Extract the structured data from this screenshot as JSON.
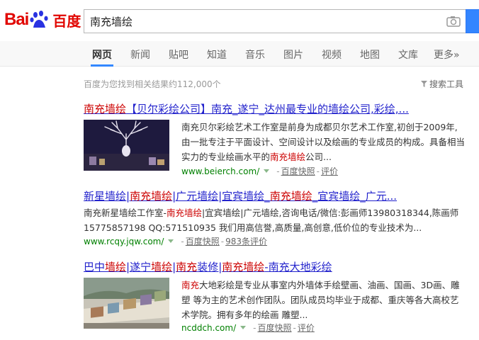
{
  "logo": {
    "text_left": "Bai",
    "text_right": "du",
    "text_cn": "百度"
  },
  "search": {
    "query": "南充墙绘"
  },
  "nav": {
    "tabs": [
      {
        "label": "网页",
        "active": true
      },
      {
        "label": "新闻"
      },
      {
        "label": "贴吧"
      },
      {
        "label": "知道"
      },
      {
        "label": "音乐"
      },
      {
        "label": "图片"
      },
      {
        "label": "视频"
      },
      {
        "label": "地图"
      },
      {
        "label": "文库"
      },
      {
        "label": "更多»"
      }
    ]
  },
  "meta": {
    "result_count": "百度为您找到相关结果约112,000个",
    "tools_label": "搜索工具"
  },
  "results": [
    {
      "title": [
        {
          "t": "南充墙绘",
          "hl": true
        },
        {
          "t": "【贝尔彩绘公司】南充_遂宁_达州最专业的墙绘公司,彩绘,...",
          "hl": false
        }
      ],
      "desc": [
        {
          "t": "南充贝尔彩绘艺术工作室是前身为成都贝尔艺术工作室,初创于2009年,由一批专注于平面设计、空间设计以及绘画的专业成员的构成。具备相当实力的专业绘画水平的",
          "hl": false
        },
        {
          "t": "南充墙绘",
          "hl": true
        },
        {
          "t": "公司...",
          "hl": false
        }
      ],
      "url": "www.beierch.com/",
      "snapshot": "百度快照",
      "rating": "评价"
    },
    {
      "title": [
        {
          "t": "新星墙绘|",
          "hl": false
        },
        {
          "t": "南充墙绘",
          "hl": true
        },
        {
          "t": "|广元墙绘|宜宾墙绘_",
          "hl": false
        },
        {
          "t": "南充墙绘",
          "hl": true
        },
        {
          "t": "_宜宾墙绘_广元...",
          "hl": false
        }
      ],
      "desc": [
        {
          "t": "南充新星墙绘工作室-",
          "hl": false
        },
        {
          "t": "南充墙绘",
          "hl": true
        },
        {
          "t": "|宜宾墙绘|广元墙绘,咨询电话/微信:彭画师13980318344,陈画师15775857198 QQ:571510935 我们用高信誉,高质量,高创意,低价位的专业技术为...",
          "hl": false
        }
      ],
      "url": "www.rcqy.jqw.com/",
      "snapshot": "百度快照",
      "rating": "983条评价"
    },
    {
      "title": [
        {
          "t": "巴中",
          "hl": false
        },
        {
          "t": "墙绘",
          "hl": true
        },
        {
          "t": "|遂宁",
          "hl": false
        },
        {
          "t": "墙绘",
          "hl": true
        },
        {
          "t": "|",
          "hl": false
        },
        {
          "t": "南充",
          "hl": true
        },
        {
          "t": "装修|",
          "hl": false
        },
        {
          "t": "南充墙绘",
          "hl": true
        },
        {
          "t": "-南充大地彩绘",
          "hl": false
        }
      ],
      "desc": [
        {
          "t": "南充",
          "hl": true
        },
        {
          "t": "大地彩绘是专业从事室内外墙体手绘壁画、油画、国画、3D画、雕塑 等为主的艺术创作团队。团队成员均毕业于成都、重庆等各大高校艺术学院。拥有多年的绘画 雕塑...",
          "hl": false
        }
      ],
      "url": "ncddch.com/",
      "snapshot": "百度快照",
      "rating": "评价"
    }
  ],
  "colors": {
    "brand_red": "#e10601",
    "link_blue": "#2222cc",
    "highlight_red": "#cc0000",
    "url_green": "#008000",
    "button_blue": "#3385ff"
  }
}
